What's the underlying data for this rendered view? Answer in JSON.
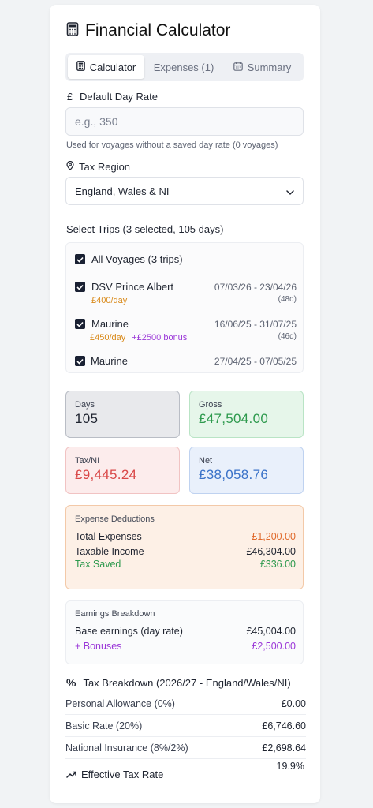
{
  "app": {
    "title": "Financial Calculator"
  },
  "tabs": [
    {
      "label": "Calculator",
      "icon": "calculator-icon",
      "active": true
    },
    {
      "label": "Expenses (1)",
      "active": false
    },
    {
      "label": "Summary",
      "icon": "calendar-icon",
      "active": false
    }
  ],
  "day_rate": {
    "label": "Default Day Rate",
    "currency_symbol": "£",
    "placeholder": "e.g., 350",
    "value": "",
    "hint": "Used for voyages without a saved day rate (0 voyages)"
  },
  "tax_region": {
    "label": "Tax Region",
    "selected": "England, Wales & NI"
  },
  "trips": {
    "heading": "Select Trips (3 selected, 105 days)",
    "all_label": "All Voyages (3 trips)",
    "items": [
      {
        "name": "DSV Prince Albert",
        "dates": "07/03/26 - 23/04/26",
        "duration": "(48d)",
        "rate": "£400/day",
        "bonus": ""
      },
      {
        "name": "Maurine",
        "dates": "16/06/25 - 31/07/25",
        "duration": "(46d)",
        "rate": "£450/day",
        "bonus": "+£2500 bonus"
      },
      {
        "name": "Maurine",
        "dates": "27/04/25 - 07/05/25",
        "duration": "",
        "rate": "",
        "bonus": ""
      }
    ]
  },
  "stats": {
    "days": {
      "label": "Days",
      "value": "105"
    },
    "gross": {
      "label": "Gross",
      "value": "£47,504.00"
    },
    "tax_ni": {
      "label": "Tax/NI",
      "value": "£9,445.24"
    },
    "net": {
      "label": "Net",
      "value": "£38,058.76"
    }
  },
  "expense_deductions": {
    "title": "Expense Deductions",
    "total_expenses_label": "Total Expenses",
    "total_expenses_value": "-£1,200.00",
    "taxable_income_label": "Taxable Income",
    "taxable_income_value": "£46,304.00",
    "tax_saved_label": "Tax Saved",
    "tax_saved_value": "£336.00"
  },
  "earnings_breakdown": {
    "title": "Earnings Breakdown",
    "base_label": "Base earnings (day rate)",
    "base_value": "£45,004.00",
    "bonuses_label": "+ Bonuses",
    "bonuses_value": "£2,500.00"
  },
  "tax_breakdown": {
    "title": "Tax Breakdown (2026/27 - England/Wales/NI)",
    "rows": [
      {
        "label": "Personal Allowance (0%)",
        "value": "£0.00"
      },
      {
        "label": "Basic Rate (20%)",
        "value": "£6,746.60"
      },
      {
        "label": "National Insurance (8%/2%)",
        "value": "£2,698.64"
      }
    ],
    "effective_label": "Effective Tax Rate",
    "effective_value": "19.9%"
  },
  "colors": {
    "orange": "#d98a1a",
    "purple": "#9b38d8",
    "green": "#2e9a4e",
    "red": "#d94848",
    "blue": "#3a72c8"
  }
}
